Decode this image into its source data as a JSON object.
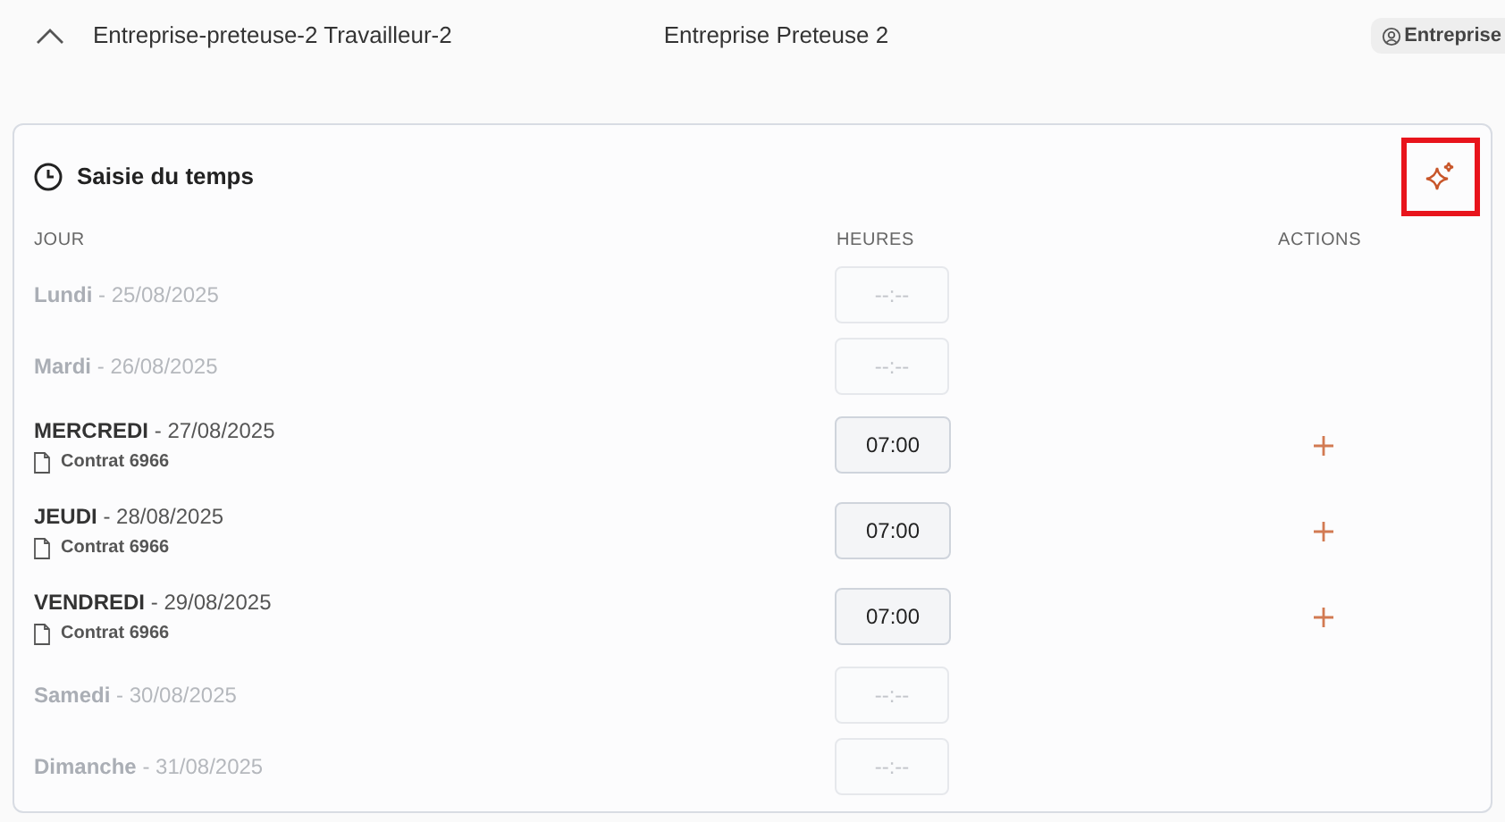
{
  "header": {
    "expanded": true,
    "worker": "Entreprise-preteuse-2 Travailleur-2",
    "company": "Entreprise Preteuse 2",
    "badge": "Entreprise"
  },
  "card": {
    "title": "Saisie du temps",
    "magic_button": {
      "highlighted": true
    },
    "columns": [
      "JOUR",
      "HEURES",
      "ACTIONS"
    ],
    "rows": [
      {
        "day": "Lundi",
        "date": "- 25/08/2025",
        "disabled": true,
        "hours_placeholder": "--:--"
      },
      {
        "day": "Mardi",
        "date": "- 26/08/2025",
        "disabled": true,
        "hours_placeholder": "--:--"
      },
      {
        "day": "MERCREDI",
        "date": "- 27/08/2025",
        "disabled": false,
        "contract": "Contrat 6966",
        "hours": "07:00"
      },
      {
        "day": "JEUDI",
        "date": "- 28/08/2025",
        "disabled": false,
        "contract": "Contrat 6966",
        "hours": "07:00"
      },
      {
        "day": "VENDREDI",
        "date": "- 29/08/2025",
        "disabled": false,
        "contract": "Contrat 6966",
        "hours": "07:00"
      },
      {
        "day": "Samedi",
        "date": "- 30/08/2025",
        "disabled": true,
        "hours_placeholder": "--:--"
      },
      {
        "day": "Dimanche",
        "date": "- 31/08/2025",
        "disabled": true,
        "hours_placeholder": "--:--"
      }
    ]
  }
}
